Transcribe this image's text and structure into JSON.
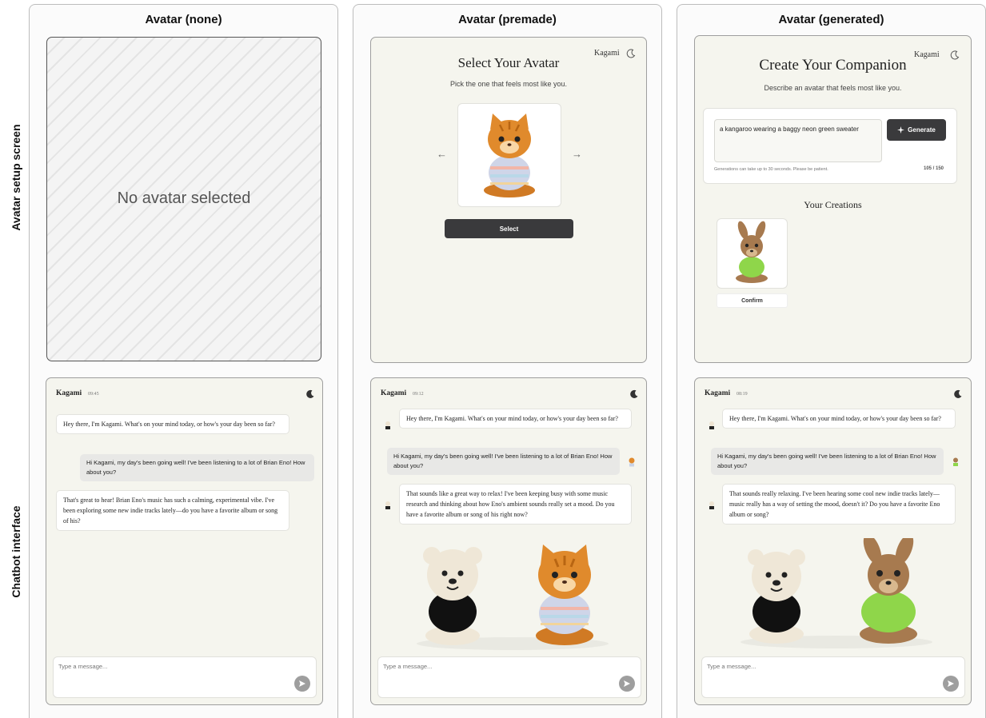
{
  "row_labels": {
    "setup": "Avatar setup screen",
    "chat": "Chatbot interface"
  },
  "columns": [
    {
      "title": "Avatar (none)"
    },
    {
      "title": "Avatar (premade)"
    },
    {
      "title": "Avatar (generated)"
    }
  ],
  "none_setup": {
    "placeholder": "No avatar selected"
  },
  "premade_setup": {
    "brand": "Kagami",
    "title": "Select Your Avatar",
    "subtitle": "Pick the one that feels most like you.",
    "prev_arrow": "←",
    "next_arrow": "→",
    "select_label": "Select",
    "avatar_icon": "cat-avatar-icon"
  },
  "generated_setup": {
    "brand": "Kagami",
    "title": "Create Your Companion",
    "subtitle": "Describe an avatar that feels most like you.",
    "prompt_value": "a kangaroo wearing a baggy neon green sweater",
    "generate_label": "Generate",
    "hint": "Generations can take up to 30 seconds. Please be patient.",
    "counter": "105 / 150",
    "creations_title": "Your Creations",
    "confirm_label": "Confirm",
    "avatar_icon": "kangaroo-avatar-icon"
  },
  "chats": [
    {
      "name": "Kagami",
      "time": "09:45",
      "messages": [
        {
          "role": "bot",
          "text": "Hey there, I'm Kagami. What's on your mind today, or how's your day been so far?"
        },
        {
          "role": "user",
          "text": "Hi Kagami, my day's been going well! I've been listening to a lot of Brian Eno! How about you?"
        },
        {
          "role": "bot",
          "text": "That's great to hear! Brian Eno's music has such a calming, experimental vibe. I've been exploring some new indie tracks lately—do you have a favorite album or song of his?"
        }
      ],
      "input_placeholder": "Type a message..."
    },
    {
      "name": "Kagami",
      "time": "09:12",
      "messages": [
        {
          "role": "bot",
          "text": "Hey there, I'm Kagami. What's on your mind today, or how's your day been so far?"
        },
        {
          "role": "user",
          "text": "Hi Kagami, my day's been going well! I've been listening to a lot of Brian Eno! How about you?"
        },
        {
          "role": "bot",
          "text": "That sounds like a great way to relax! I've been keeping busy with some music research and thinking about how Eno's ambient sounds really set a mood. Do you have a favorite album or song of his right now?"
        }
      ],
      "input_placeholder": "Type a message..."
    },
    {
      "name": "Kagami",
      "time": "08:19",
      "messages": [
        {
          "role": "bot",
          "text": "Hey there, I'm Kagami. What's on your mind today, or how's your day been so far?"
        },
        {
          "role": "user",
          "text": "Hi Kagami, my day's been going well! I've been listening to a lot of Brian Eno! How about you?"
        },
        {
          "role": "bot",
          "text": "That sounds really relaxing. I've been hearing some cool new indie tracks lately—music really has a way of setting the mood, doesn't it? Do you have a favorite Eno album or song?"
        }
      ],
      "input_placeholder": "Type a message..."
    }
  ],
  "colors": {
    "screen_bg": "#f5f5ee",
    "dark_button": "#3a3a3c",
    "cat_orange": "#e08a2c",
    "kangaroo_brown": "#a77a4f",
    "sweater_green": "#8fd64a"
  }
}
